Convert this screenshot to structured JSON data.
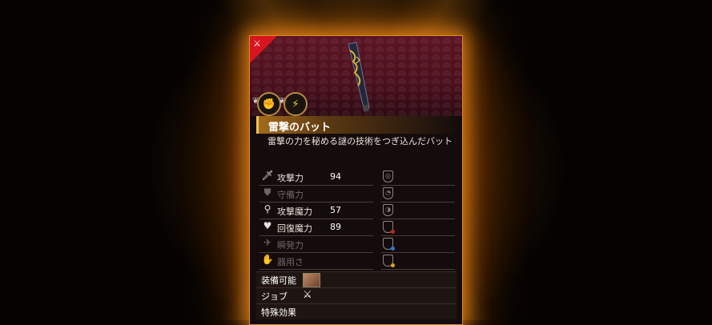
{
  "item": {
    "name": "雷撃のバット",
    "description": "雷撃の力を秘める謎の技術をつぎ込んだバット",
    "badges": [
      "fist-icon",
      "lightning-icon"
    ]
  },
  "stats": [
    {
      "label": "攻撃力",
      "value": "94",
      "icon": "sword-icon",
      "dim": false
    },
    {
      "label": "守備力",
      "value": "",
      "icon": "shield-icon",
      "dim": true
    },
    {
      "label": "攻撃魔力",
      "value": "57",
      "icon": "magic-wand-icon",
      "dim": false
    },
    {
      "label": "回復魔力",
      "value": "89",
      "icon": "heart-icon",
      "dim": false
    },
    {
      "label": "瞬発力",
      "value": "",
      "icon": "running-icon",
      "dim": true
    },
    {
      "label": "器用さ",
      "value": "",
      "icon": "hand-icon",
      "dim": true
    }
  ],
  "resistances": [
    {
      "icon": "resist-icon",
      "dot": ""
    },
    {
      "icon": "resist-icon",
      "dot": ""
    },
    {
      "icon": "resist-icon",
      "dot": ""
    },
    {
      "icon": "resist-fire-icon",
      "dot": "#c8202a"
    },
    {
      "icon": "resist-water-icon",
      "dot": "#2a7ad8"
    },
    {
      "icon": "resist-earth-icon",
      "dot": "#d8a020"
    }
  ],
  "sections": {
    "equip_label": "装備可能",
    "job_label": "ジョブ",
    "special_label": "特殊効果"
  },
  "colors": {
    "glow": "#ff9a1e",
    "header": "#5c1424",
    "tag": "#d8141e",
    "title_accent": "#f0c25a"
  }
}
